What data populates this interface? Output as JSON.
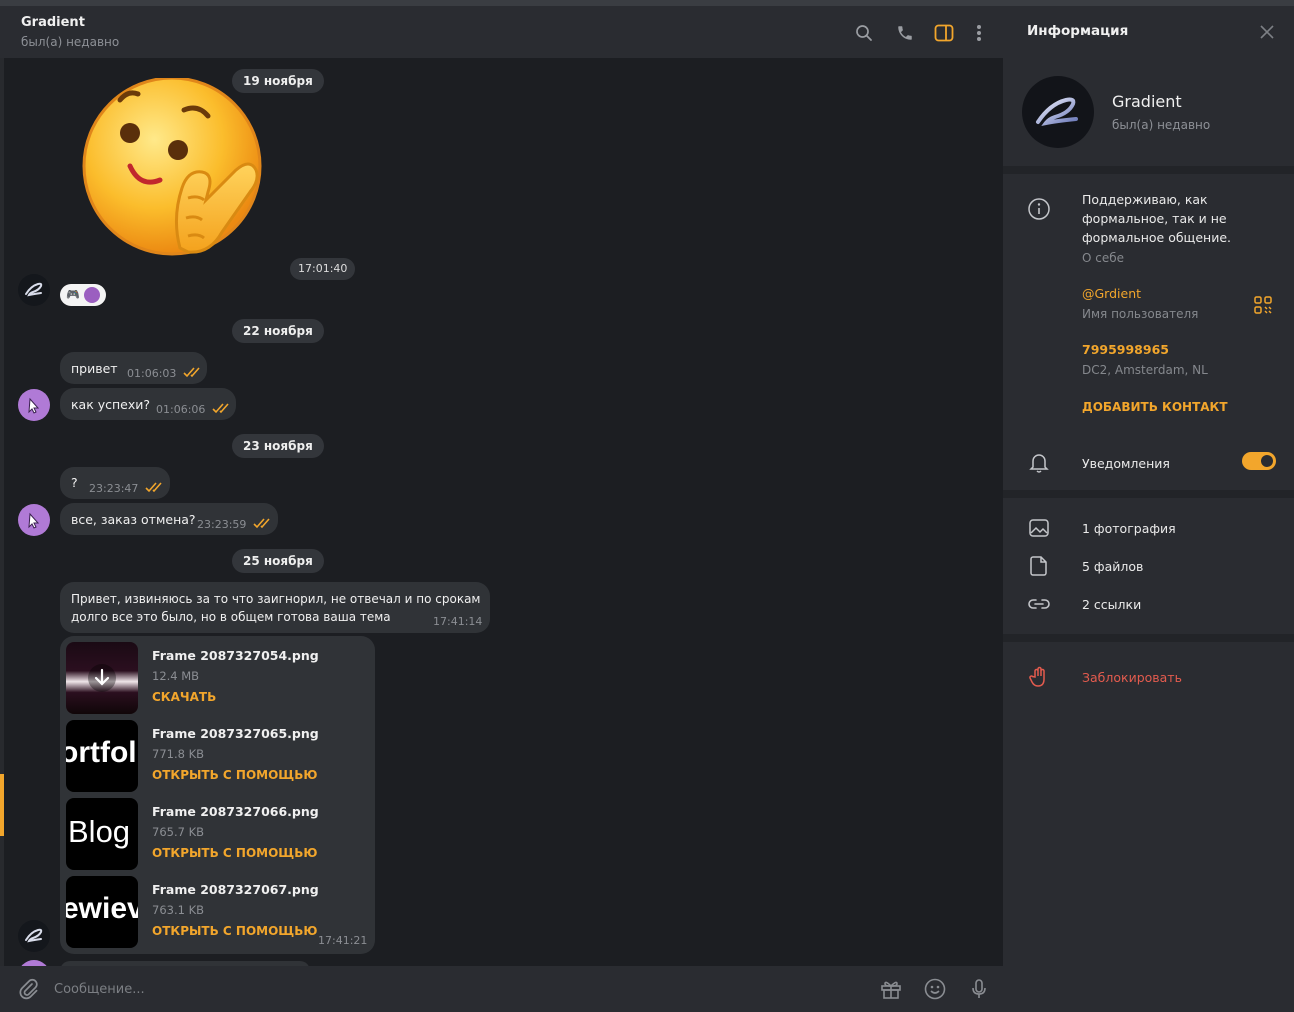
{
  "header": {
    "title": "Gradient",
    "status": "был(а) недавно",
    "icons": [
      "search-icon",
      "phone-icon",
      "sidebar-toggle-icon",
      "more-vertical-icon"
    ]
  },
  "messages": {
    "dates": [
      "19 ноября",
      "22 ноября",
      "23 ноября",
      "25 ноября"
    ],
    "sticker_time": "17:01:40",
    "reaction": "🎮",
    "m1": {
      "text": "привет",
      "time": "01:06:03"
    },
    "m2": {
      "text": "как успехи?",
      "time": "01:06:06"
    },
    "m3": {
      "text": "?",
      "time": "23:23:47"
    },
    "m4": {
      "text": "все, заказ отмена?",
      "time": "23:23:59"
    },
    "m5": {
      "line1": "Привет, извиняюсь за то что заигнорил, не отвечал и по срокам",
      "line2": "долго все это было, но в общем готова ваша тема",
      "time": "17:41:14"
    },
    "files": [
      {
        "name": "Frame 2087327054.png",
        "size": "12.4 MB",
        "action": "СКАЧАТЬ",
        "thumb_text": ""
      },
      {
        "name": "Frame 2087327065.png",
        "size": "771.8 KB",
        "action": "ОТКРЫТЬ С ПОМОЩЬЮ",
        "thumb_text": "ortfol"
      },
      {
        "name": "Frame 2087327066.png",
        "size": "765.7 KB",
        "action": "ОТКРЫТЬ С ПОМОЩЬЮ",
        "thumb_text": "Blog"
      },
      {
        "name": "Frame 2087327067.png",
        "size": "763.1 KB",
        "action": "ОТКРЫТЬ С ПОМОЩЬЮ",
        "thumb_text": "ewiev"
      }
    ],
    "files_time": "17:41:21"
  },
  "composer": {
    "placeholder": "Сообщение..."
  },
  "info_panel": {
    "title": "Информация",
    "name": "Gradient",
    "status": "был(а) недавно",
    "bio_lines": [
      "Поддерживаю, как",
      "формальное, так и не",
      "формальное общение."
    ],
    "bio_label": "О себе",
    "username": "@Grdient",
    "username_label": "Имя пользователя",
    "phone": "7995998965",
    "phone_label": "DC2, Amsterdam, NL",
    "add_contact": "ДОБАВИТЬ КОНТАКТ",
    "notifications": "Уведомления",
    "notifications_on": true,
    "photos": "1 фотография",
    "files": "5 файлов",
    "links": "2 ссылки",
    "block": "Заблокировать"
  },
  "colors": {
    "accent": "#f2a62c",
    "danger": "#e35b4e",
    "bubble": "#303337",
    "chat_bg": "#1c1e22",
    "panel_bg": "#2a2c31"
  }
}
